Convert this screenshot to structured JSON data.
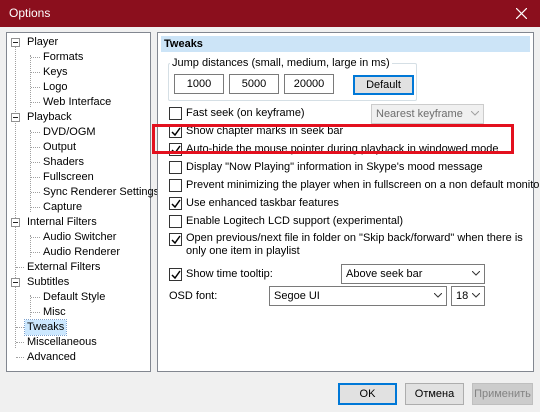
{
  "window": {
    "title": "Options",
    "close_icon": "close-icon"
  },
  "tree": {
    "items": [
      {
        "label": "Player"
      },
      {
        "label": "Formats"
      },
      {
        "label": "Keys"
      },
      {
        "label": "Logo"
      },
      {
        "label": "Web Interface"
      },
      {
        "label": "Playback"
      },
      {
        "label": "DVD/OGM"
      },
      {
        "label": "Output"
      },
      {
        "label": "Shaders"
      },
      {
        "label": "Fullscreen"
      },
      {
        "label": "Sync Renderer Settings"
      },
      {
        "label": "Capture"
      },
      {
        "label": "Internal Filters"
      },
      {
        "label": "Audio Switcher"
      },
      {
        "label": "Audio Renderer"
      },
      {
        "label": "External Filters"
      },
      {
        "label": "Subtitles"
      },
      {
        "label": "Default Style"
      },
      {
        "label": "Misc"
      },
      {
        "label": "Tweaks"
      },
      {
        "label": "Miscellaneous"
      },
      {
        "label": "Advanced"
      }
    ]
  },
  "panel": {
    "header": "Tweaks",
    "jump_group_label": "Jump distances (small, medium, large in ms)",
    "jump_small": "1000",
    "jump_medium": "5000",
    "jump_large": "20000",
    "default_button": "Default",
    "fast_seek_label": "Fast seek (on keyframe)",
    "fast_seek_mode": "Nearest keyframe",
    "checkboxes": [
      {
        "label": "Show chapter marks in seek bar",
        "checked": true
      },
      {
        "label": "Auto-hide the mouse pointer during playback in windowed mode",
        "checked": true
      },
      {
        "label": "Display \"Now Playing\" information in Skype's mood message",
        "checked": false
      },
      {
        "label": "Prevent minimizing the player when in fullscreen on a non default monitor",
        "checked": false
      },
      {
        "label": "Use enhanced taskbar features",
        "checked": true
      },
      {
        "label": "Enable Logitech LCD support (experimental)",
        "checked": false
      },
      {
        "label": "Open previous/next file in folder on \"Skip back/forward\" when there is only one item in playlist",
        "checked": true
      }
    ],
    "time_tooltip_label": "Show time tooltip:",
    "time_tooltip_value": "Above seek bar",
    "osd_font_label": "OSD font:",
    "osd_font_value": "Segoe UI",
    "osd_size_value": "18"
  },
  "buttons": {
    "ok": "OK",
    "cancel": "Отмена",
    "apply": "Применить"
  },
  "colors": {
    "titlebar": "#8b0f1d",
    "highlight_box": "#e3101e",
    "header_bg": "#cce4f7",
    "selection": "#cce8ff"
  }
}
